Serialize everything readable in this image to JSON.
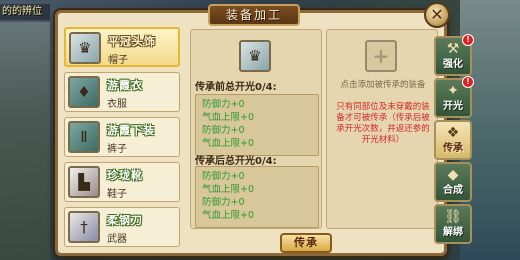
{
  "background": {
    "top_left_text": "的的辨位"
  },
  "window": {
    "title": "装备加工",
    "close_label": "✕"
  },
  "equipment_list": [
    {
      "name": "平冠头饰",
      "type": "帽子",
      "icon": "hat-icon",
      "selected": true
    },
    {
      "name": "游霞衣",
      "type": "衣服",
      "icon": "robe-icon",
      "selected": false
    },
    {
      "name": "游霞下装",
      "type": "裤子",
      "icon": "pants-icon",
      "selected": false
    },
    {
      "name": "珍珑靴",
      "type": "鞋子",
      "icon": "boots-icon",
      "selected": false
    },
    {
      "name": "柔钢刀",
      "type": "武器",
      "icon": "sword-icon",
      "selected": false
    }
  ],
  "inherit": {
    "before_title": "传承前总开光0/4:",
    "after_title": "传承后总开光0/4:",
    "before_stats": [
      "防御力+0",
      "气血上限+0",
      "防御力+0",
      "气血上限+0"
    ],
    "after_stats": [
      "防御力+0",
      "气血上限+0",
      "防御力+0",
      "气血上限+0"
    ],
    "target_hint": "点击添加被传承的装备",
    "rule_text": "只有同部位及未穿戴的装备才可被传承（传承后被承开光次数，并返还参的开光材料）",
    "button_label": "传承"
  },
  "side_tabs": [
    {
      "label": "强化",
      "badge": "!",
      "active": false
    },
    {
      "label": "开光",
      "badge": "!",
      "active": false
    },
    {
      "label": "传承",
      "badge": "",
      "active": true
    },
    {
      "label": "合成",
      "badge": "",
      "active": false
    },
    {
      "label": "解绑",
      "badge": "",
      "active": false
    }
  ],
  "colors": {
    "stat_green": "#2e9a2e",
    "rule_red": "#d42a2a",
    "badge_red": "#e02020"
  }
}
